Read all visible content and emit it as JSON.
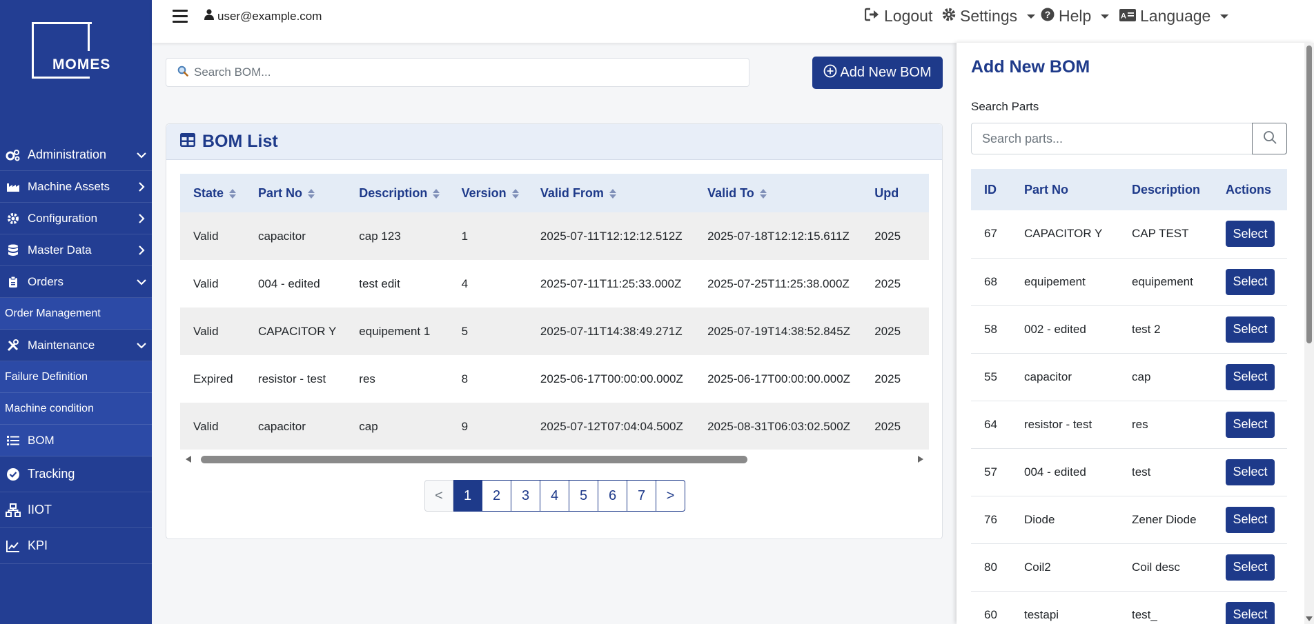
{
  "brand": {
    "logo": "MOMES"
  },
  "topbar": {
    "user": "user@example.com",
    "logout": "Logout",
    "settings": "Settings",
    "help": "Help",
    "language": "Language"
  },
  "sidebar": {
    "items": [
      {
        "label": "Administration"
      },
      {
        "label": "Machine Assets"
      },
      {
        "label": "Configuration"
      },
      {
        "label": "Master Data"
      },
      {
        "label": "Orders"
      },
      {
        "label": "Order Management"
      },
      {
        "label": "Maintenance"
      },
      {
        "label": "Failure Definition"
      },
      {
        "label": "Machine condition"
      },
      {
        "label": "BOM"
      },
      {
        "label": "Tracking"
      },
      {
        "label": "IIOT"
      },
      {
        "label": "KPI"
      }
    ]
  },
  "main": {
    "search_placeholder": "Search BOM...",
    "add_button": "Add New BOM",
    "list_title": "BOM List",
    "columns": [
      "State",
      "Part No",
      "Description",
      "Version",
      "Valid From",
      "Valid To",
      "Upd"
    ],
    "rows": [
      {
        "state": "Valid",
        "part_no": "capacitor",
        "description": "cap 123",
        "version": "1",
        "valid_from": "2025-07-11T12:12:12.512Z",
        "valid_to": "2025-07-18T12:12:15.611Z",
        "updated": "2025"
      },
      {
        "state": "Valid",
        "part_no": "004 - edited",
        "description": "test edit",
        "version": "4",
        "valid_from": "2025-07-11T11:25:33.000Z",
        "valid_to": "2025-07-25T11:25:38.000Z",
        "updated": "2025"
      },
      {
        "state": "Valid",
        "part_no": "CAPACITOR Y",
        "description": "equipement 1",
        "version": "5",
        "valid_from": "2025-07-11T14:38:49.271Z",
        "valid_to": "2025-07-19T14:38:52.845Z",
        "updated": "2025"
      },
      {
        "state": "Expired",
        "part_no": "resistor - test",
        "description": "res",
        "version": "8",
        "valid_from": "2025-06-17T00:00:00.000Z",
        "valid_to": "2025-06-17T00:00:00.000Z",
        "updated": "2025"
      },
      {
        "state": "Valid",
        "part_no": "capacitor",
        "description": "cap",
        "version": "9",
        "valid_from": "2025-07-12T07:04:04.500Z",
        "valid_to": "2025-08-31T06:03:02.500Z",
        "updated": "2025"
      }
    ],
    "pagination": {
      "prev": "<",
      "pages": [
        "1",
        "2",
        "3",
        "4",
        "5",
        "6",
        "7"
      ],
      "next": ">",
      "current": "1"
    }
  },
  "panel": {
    "title": "Add New BOM",
    "search_label": "Search Parts",
    "search_placeholder": "Search parts...",
    "columns": [
      "ID",
      "Part No",
      "Description",
      "Actions"
    ],
    "select_label": "Select",
    "parts": [
      {
        "id": "67",
        "part_no": "CAPACITOR Y",
        "description": "CAP TEST"
      },
      {
        "id": "68",
        "part_no": "equipement",
        "description": "equipement"
      },
      {
        "id": "58",
        "part_no": "002 - edited",
        "description": "test 2"
      },
      {
        "id": "55",
        "part_no": "capacitor",
        "description": "cap"
      },
      {
        "id": "64",
        "part_no": "resistor - test",
        "description": "res"
      },
      {
        "id": "57",
        "part_no": "004 - edited",
        "description": "test"
      },
      {
        "id": "76",
        "part_no": "Diode",
        "description": "Zener Diode"
      },
      {
        "id": "80",
        "part_no": "Coil2",
        "description": "Coil desc"
      },
      {
        "id": "60",
        "part_no": "testapi",
        "description": "test_"
      }
    ]
  },
  "colors": {
    "sidebar": "#233e93",
    "primary": "#1e3a8a",
    "header_bg": "#e4ecf6"
  }
}
